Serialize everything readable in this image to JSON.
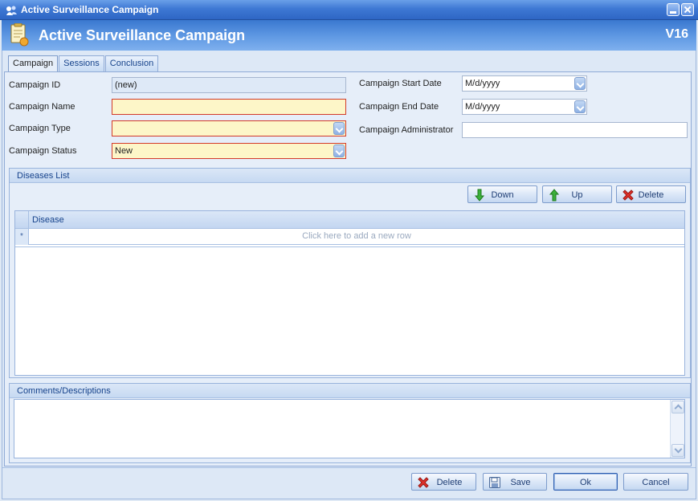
{
  "window": {
    "title": "Active Surveillance Campaign"
  },
  "header": {
    "title": "Active Surveillance Campaign",
    "version": "V16"
  },
  "tabs": [
    {
      "label": "Campaign",
      "active": true
    },
    {
      "label": "Sessions",
      "active": false
    },
    {
      "label": "Conclusion",
      "active": false
    }
  ],
  "form": {
    "campaign_id": {
      "label": "Campaign ID",
      "value": "(new)"
    },
    "campaign_name": {
      "label": "Campaign Name",
      "value": ""
    },
    "campaign_type": {
      "label": "Campaign Type",
      "value": ""
    },
    "campaign_status": {
      "label": "Campaign Status",
      "value": "New"
    },
    "start_date": {
      "label": "Campaign Start Date",
      "value": "M/d/yyyy"
    },
    "end_date": {
      "label": "Campaign End Date",
      "value": "M/d/yyyy"
    },
    "administrator": {
      "label": "Campaign Administrator",
      "value": ""
    }
  },
  "diseases": {
    "title": "Diseases List",
    "buttons": {
      "down": "Down",
      "up": "Up",
      "delete": "Delete"
    },
    "columns": [
      "Disease"
    ],
    "new_row_marker": "*",
    "new_row_text": "Click here to add a new row",
    "rows": []
  },
  "comments": {
    "title": "Comments/Descriptions",
    "value": ""
  },
  "footer": {
    "delete": "Delete",
    "save": "Save",
    "ok": "Ok",
    "cancel": "Cancel"
  },
  "colors": {
    "required_bg": "#fdf6c8",
    "required_border": "#d23a2a",
    "header_blue": "#3a78cf"
  }
}
